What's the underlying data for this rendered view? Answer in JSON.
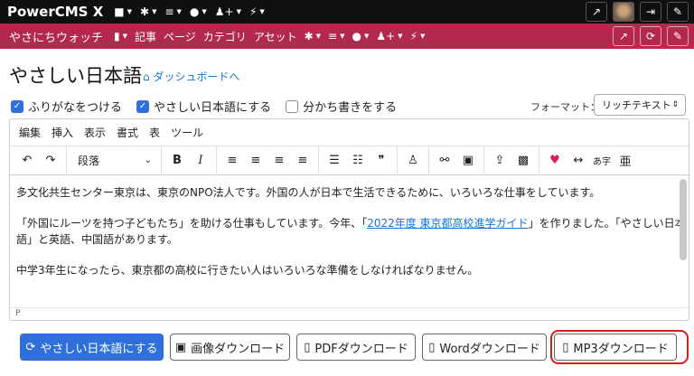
{
  "topbar": {
    "brand": "PowerCMS X",
    "icons": [
      "cube-icon",
      "gear-icon",
      "database-icon",
      "comments-icon",
      "user-plus-icon",
      "plug-icon"
    ],
    "right_icons": [
      "external-link-icon",
      "avatar",
      "sign-out-icon",
      "wrench-icon"
    ]
  },
  "subbar": {
    "site": "やさにちウォッチ",
    "bookmark_caret": "▾",
    "links": [
      "記事",
      "ページ",
      "カテゴリ",
      "アセット"
    ],
    "right_icons": [
      "external-link-icon",
      "refresh-icon",
      "wrench-icon"
    ]
  },
  "page": {
    "title": "やさしい日本語",
    "dashboard_link": "ダッシュボードへ"
  },
  "options": {
    "furigana": {
      "label": "ふりがなをつける",
      "checked": true
    },
    "yasashii": {
      "label": "やさしい日本語にする",
      "checked": true
    },
    "wakachi": {
      "label": "分かち書きをする",
      "checked": false
    },
    "format_label": "フォーマット：",
    "format_value": "リッチテキスト"
  },
  "editor": {
    "menu": [
      "編集",
      "挿入",
      "表示",
      "書式",
      "表",
      "ツール"
    ],
    "paragraph_select": "段落",
    "content": {
      "p1": "多文化共生センター東京は、東京のNPO法人です。外国の人が日本で生活できるために、いろいろな仕事をしています。",
      "p2_before": "「外国にルーツを持つ子どもたち」を助ける仕事もしています。今年、「",
      "p2_link": "2022年度 東京都高校進学ガイド",
      "p2_after": "」を作りました。「やさしい日本語」と英語、中国語があります。",
      "p3": "中学3年生になったら、東京都の高校に行きたい人はいろいろな準備をしなければなりません。"
    },
    "status_path": "P"
  },
  "actions": {
    "primary": "やさしい日本語にする",
    "image": "画像ダウンロード",
    "pdf": "PDFダウンロード",
    "word": "Wordダウンロード",
    "mp3": "MP3ダウンロード"
  },
  "colors": {
    "topbar": "#0f0f0f",
    "subbar": "#b5284e",
    "primary": "#2f6fdb",
    "link": "#1a73d9",
    "highlight": "#d81b1b"
  }
}
